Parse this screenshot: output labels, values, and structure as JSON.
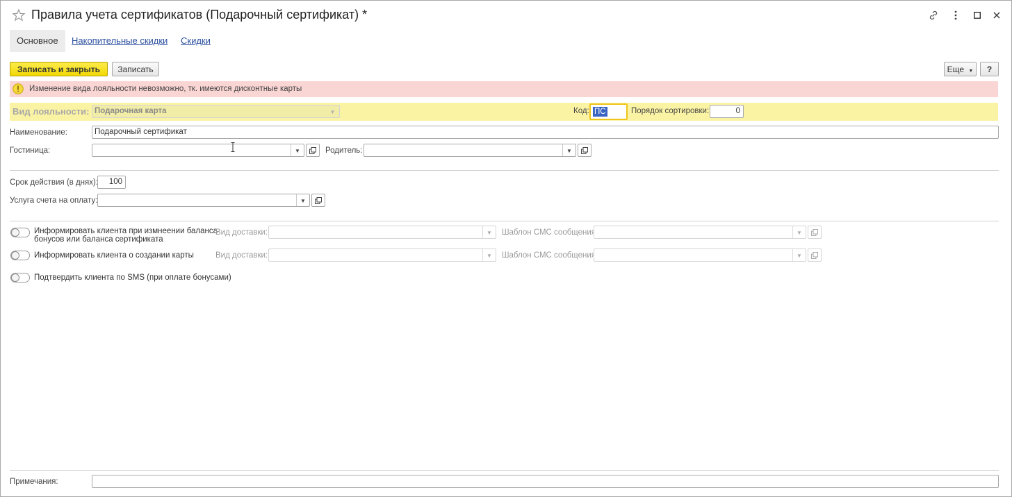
{
  "window": {
    "title": "Правила учета сертификатов (Подарочный сертификат) *",
    "controls": [
      "link-icon",
      "more-vert-icon",
      "maximize-icon",
      "close-icon"
    ]
  },
  "tabs": [
    {
      "label": "Основное",
      "active": true
    },
    {
      "label": "Накопительные скидки",
      "active": false
    },
    {
      "label": "Скидки",
      "active": false
    }
  ],
  "toolbar": {
    "save_close_label": "Записать и закрыть",
    "save_label": "Записать",
    "more_label": "Еще",
    "help_label": "?"
  },
  "warning": {
    "text": "Изменение вида лояльности невозможно, тк. имеются дисконтные карты"
  },
  "loyalty": {
    "label": "Вид лояльности:",
    "value": "Подарочная карта",
    "code_label": "Код:",
    "code_value": "ПС",
    "sort_label": "Порядок сортировки:",
    "sort_value": "0"
  },
  "fields": {
    "name_label": "Наименование:",
    "name_value": "Подарочный сертификат",
    "hotel_label": "Гостиница:",
    "hotel_value": "",
    "parent_label": "Родитель:",
    "parent_value": "",
    "validity_label": "Срок действия (в днях):",
    "validity_value": "100",
    "service_label": "Услуга счета на оплату:",
    "service_value": ""
  },
  "notifications": {
    "balance_label_line1": "Информировать клиента при измнеении баланса",
    "balance_label_line2": "бонусов или баланса сертификата",
    "creation_label": "Информировать клиента о создании карты",
    "sms_confirm_label": "Подтвердить клиента по SMS (при оплате бонусами)",
    "delivery_label": "Вид доставки:",
    "sms_template_label": "Шаблон СМС сообщения:"
  },
  "notes": {
    "label": "Примечания:",
    "value": ""
  },
  "colors": {
    "primary_button": "#f2d804",
    "warning_bg": "#f9d5d3",
    "highlight_bg": "#fbf3a4",
    "link": "#2b4f9f",
    "focus": "#f0c419"
  }
}
